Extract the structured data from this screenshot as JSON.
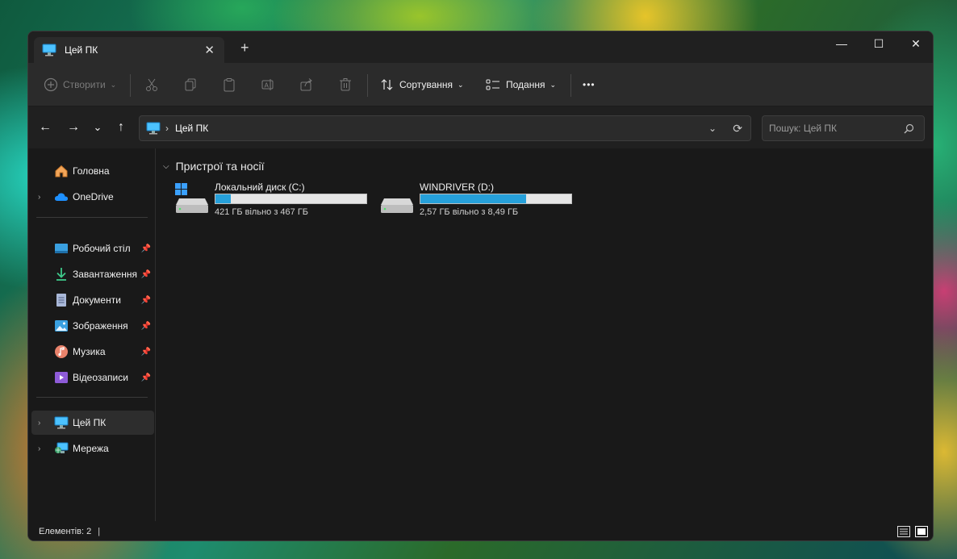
{
  "window": {
    "tab_title": "Цей ПК",
    "tab_close": "✕",
    "new_tab": "+",
    "controls": {
      "minimize": "—",
      "maximize": "☐",
      "close": "✕"
    }
  },
  "toolbar": {
    "create_label": "Створити",
    "sort_label": "Сортування",
    "view_label": "Подання",
    "more_label": "•••"
  },
  "address": {
    "crumb": "Цей ПК",
    "search_placeholder": "Пошук: Цей ПК"
  },
  "sidebar": {
    "items": [
      {
        "label": "Головна",
        "icon": "home-icon"
      },
      {
        "label": "OneDrive",
        "icon": "cloud-icon"
      },
      {
        "label": "Робочий стіл",
        "icon": "desktop-icon"
      },
      {
        "label": "Завантаження",
        "icon": "download-icon"
      },
      {
        "label": "Документи",
        "icon": "document-icon"
      },
      {
        "label": "Зображення",
        "icon": "image-icon"
      },
      {
        "label": "Музика",
        "icon": "music-icon"
      },
      {
        "label": "Відеозаписи",
        "icon": "video-icon"
      },
      {
        "label": "Цей ПК",
        "icon": "computer-icon"
      },
      {
        "label": "Мережа",
        "icon": "network-icon"
      }
    ]
  },
  "main": {
    "group_title": "Пристрої та носії",
    "drives": [
      {
        "name": "Локальний диск (C:)",
        "free_text": "421 ГБ вільно з 467 ГБ",
        "used_fraction": 0.1
      },
      {
        "name": "WINDRIVER (D:)",
        "free_text": "2,57 ГБ вільно з 8,49 ГБ",
        "used_fraction": 0.7
      }
    ]
  },
  "status": {
    "items_label": "Елементів: 2",
    "separator": "|"
  },
  "colors": {
    "accent": "#26a0da",
    "window_bg": "#191919",
    "toolbar_bg": "#2b2b2b"
  }
}
